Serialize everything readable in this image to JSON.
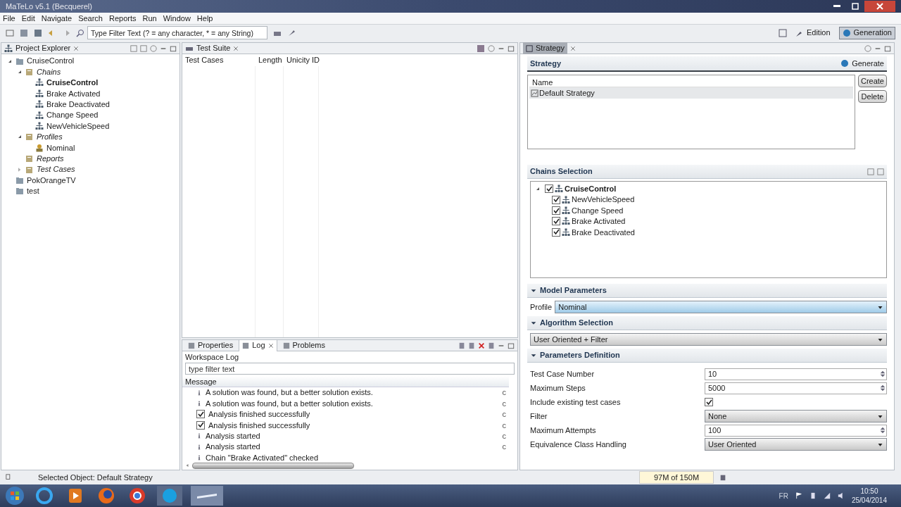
{
  "window": {
    "title": "MaTeLo v5.1 (Becquerel)"
  },
  "menu": [
    "File",
    "Edit",
    "Navigate",
    "Search",
    "Reports",
    "Run",
    "Window",
    "Help"
  ],
  "toolbar": {
    "filter_placeholder": "Type Filter Text (? = any character, * = any String)"
  },
  "perspectives": [
    {
      "label": "Edition",
      "selected": false
    },
    {
      "label": "Generation",
      "selected": true
    }
  ],
  "project_explorer": {
    "tab": "Project Explorer",
    "tree": [
      {
        "label": "CruiseControl",
        "kind": "project",
        "expanded": true,
        "bold": false,
        "children": [
          {
            "label": "Chains",
            "kind": "folder",
            "expanded": true,
            "bold": false,
            "children": [
              {
                "label": "CruiseControl",
                "kind": "chain",
                "bold": true
              },
              {
                "label": "Brake Activated",
                "kind": "chain",
                "bold": false
              },
              {
                "label": "Brake Deactivated",
                "kind": "chain",
                "bold": false
              },
              {
                "label": "Change Speed",
                "kind": "chain",
                "bold": false
              },
              {
                "label": "NewVehicleSpeed",
                "kind": "chain",
                "bold": false
              }
            ]
          },
          {
            "label": "Profiles",
            "kind": "folder",
            "expanded": true,
            "bold": false,
            "children": [
              {
                "label": "Nominal",
                "kind": "profile",
                "bold": false
              }
            ]
          },
          {
            "label": "Reports",
            "kind": "folder",
            "bold": false
          },
          {
            "label": "Test Cases",
            "kind": "folder",
            "expanded": false,
            "bold": false
          }
        ]
      },
      {
        "label": "PokOrangeTV",
        "kind": "project",
        "bold": false
      },
      {
        "label": "test",
        "kind": "project",
        "bold": false
      }
    ]
  },
  "test_suite": {
    "tab": "Test Suite",
    "columns": [
      "Test Cases",
      "Length",
      "Unicity ID"
    ]
  },
  "log_panel": {
    "tabs": [
      {
        "label": "Properties",
        "selected": false
      },
      {
        "label": "Log",
        "selected": true
      },
      {
        "label": "Problems",
        "selected": false
      }
    ],
    "title": "Workspace Log",
    "filter_placeholder": "type filter text",
    "column": "Message",
    "rows": [
      {
        "kind": "info",
        "message": "A solution was found, but a better solution exists.",
        "column_2": "c"
      },
      {
        "kind": "info",
        "message": "A solution was found, but a better solution exists.",
        "column_2": "c"
      },
      {
        "kind": "ok",
        "message": "Analysis finished successfully",
        "column_2": "c"
      },
      {
        "kind": "ok",
        "message": "Analysis finished successfully",
        "column_2": "c"
      },
      {
        "kind": "info",
        "message": "Analysis started",
        "column_2": "c"
      },
      {
        "kind": "info",
        "message": "Analysis started",
        "column_2": "c"
      },
      {
        "kind": "info",
        "message": "Chain \"Brake Activated\" checked"
      }
    ]
  },
  "strategy": {
    "tab": "Strategy",
    "title": "Strategy",
    "generate": "Generate",
    "column": "Name",
    "rows": [
      {
        "name": "Default Strategy",
        "selected": true
      }
    ],
    "buttons": [
      "Create",
      "Delete"
    ],
    "chains_title": "Chains Selection",
    "chains": [
      {
        "label": "CruiseControl",
        "checked": true,
        "expanded": true,
        "children": [
          {
            "label": "NewVehicleSpeed",
            "checked": true
          },
          {
            "label": "Change Speed",
            "checked": true
          },
          {
            "label": "Brake Activated",
            "checked": true
          },
          {
            "label": "Brake Deactivated",
            "checked": true
          }
        ]
      }
    ],
    "model_title": "Model Parameters",
    "model_expanded": true,
    "profile_label": "Profile",
    "profile_value": "Nominal",
    "algorithm_title": "Algorithm Selection",
    "algorithm_expanded": true,
    "algorithm_value": "User Oriented + Filter",
    "params_title": "Parameters Definition",
    "params_expanded": true,
    "params": [
      {
        "kind": "spinner",
        "label": "Test Case Number",
        "value": "10"
      },
      {
        "kind": "spinner",
        "label": "Maximum Steps",
        "value": "5000"
      },
      {
        "kind": "checkbox",
        "label": "Include existing test cases",
        "checked": true
      },
      {
        "kind": "select",
        "label": "Filter",
        "value": "None"
      },
      {
        "kind": "spinner",
        "label": "Maximum Attempts",
        "value": "100"
      },
      {
        "kind": "select",
        "label": "Equivalence Class Handling",
        "value": "User Oriented"
      }
    ]
  },
  "status_bar": {
    "text": "Selected Object: Default Strategy",
    "memory": "97M of 150M"
  },
  "taskbar": {
    "language": "FR",
    "time": "10:50",
    "date": "25/04/2014"
  }
}
